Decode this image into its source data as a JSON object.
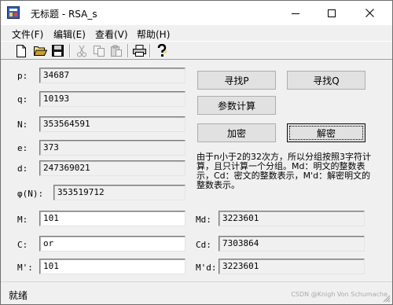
{
  "window": {
    "title": "无标题 - RSA_s",
    "controls": [
      "minimize",
      "maximize",
      "close"
    ]
  },
  "menu": [
    "文件(F)",
    "编辑(E)",
    "查看(V)",
    "帮助(H)"
  ],
  "toolbar": {
    "icons": [
      "new-file-icon",
      "open-folder-icon",
      "save-icon",
      "cut-icon",
      "copy-icon",
      "paste-icon",
      "print-icon",
      "help-icon"
    ]
  },
  "fields": {
    "p": {
      "label": "p:",
      "value": "34687"
    },
    "q": {
      "label": "q:",
      "value": "10193"
    },
    "n": {
      "label": "N:",
      "value": "353564591"
    },
    "e": {
      "label": "e:",
      "value": "373"
    },
    "d": {
      "label": "d:",
      "value": "247369021"
    },
    "phi": {
      "label": "φ(N):",
      "value": "353519712"
    },
    "m": {
      "label": "M:",
      "value": "101"
    },
    "md": {
      "label": "Md:",
      "value": "3223601"
    },
    "c": {
      "label": "C:",
      "value": "or"
    },
    "cd": {
      "label": "Cd:",
      "value": "7303864"
    },
    "m2": {
      "label": "M':",
      "value": "101"
    },
    "m2d": {
      "label": "M'd:",
      "value": "3223601"
    }
  },
  "buttons": {
    "find_p": "寻找P",
    "find_q": "寻找Q",
    "compute": "参数计算",
    "encrypt": "加密",
    "decrypt": "解密"
  },
  "description": "由于n小于2的32次方，所以分组按照3字符计算，且只计算一个分组。Md：明文的整数表示，Cd：密文的整数表示，M'd：解密明文的整数表示。",
  "status": "就绪",
  "watermark": "CSDN @Knigh Von Schumache"
}
